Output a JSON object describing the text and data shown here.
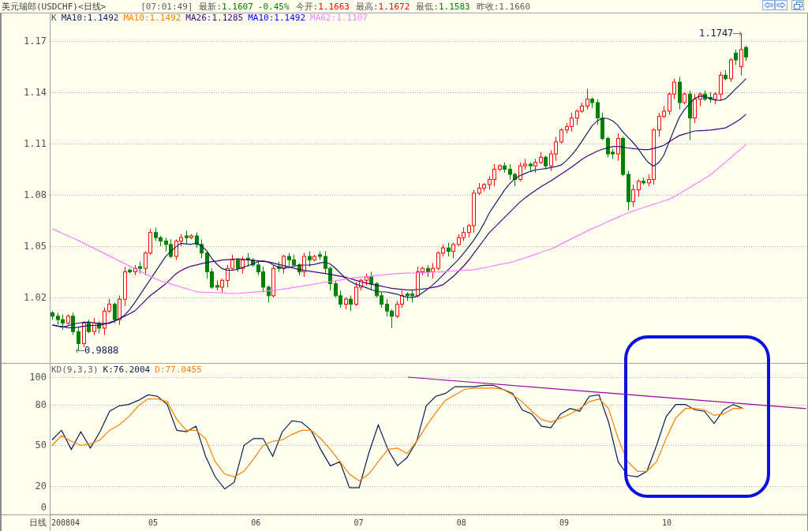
{
  "header": {
    "title": "美元瑞郎(USDCHF)<日线>",
    "time": "[07:01:49]",
    "quotes": [
      {
        "label": "最新:",
        "value": "1.1607",
        "change": "-0.45%",
        "color": "#008000"
      },
      {
        "label": "今开:",
        "value": "1.1663",
        "color": "#ff0000"
      },
      {
        "label": "最高:",
        "value": "1.1672",
        "color": "#ff0000"
      },
      {
        "label": "最低:",
        "value": "1.1583",
        "color": "#008000"
      },
      {
        "label": "昨收:",
        "value": "1.1660",
        "color": "#606060"
      }
    ]
  },
  "price_chart": {
    "legend": [
      {
        "kind": "label",
        "text": "K",
        "color": "#505050"
      },
      {
        "kind": "series",
        "reading": ":1.1492"
      },
      {
        "kind": "label",
        "text": "MA10:1.1492",
        "color": "#ff8000"
      },
      {
        "kind": "series",
        "reading": ":1.1285"
      },
      {
        "kind": "label",
        "text": "MA10:1.1492",
        "color": "#0000ff"
      },
      {
        "kind": "series",
        "reading": ":1.1107"
      }
    ],
    "high_label": "1.1747",
    "low_label": "0.9888",
    "chart_data": {
      "type": "candlestick",
      "xlim": [
        3.525,
        11.366
      ],
      "ylim": [
        0.9812,
        1.1862
      ],
      "yticks": [
        1.17,
        1.14,
        1.11,
        1.08,
        1.05,
        1.02
      ],
      "grid": true,
      "x": [
        4.02,
        4.07,
        4.12,
        4.17,
        4.22,
        4.27,
        4.32,
        4.37,
        4.42,
        4.47,
        4.52,
        4.57,
        4.62,
        4.67,
        4.72,
        4.77,
        4.82,
        4.87,
        4.92,
        4.97,
        5.02,
        5.07,
        5.12,
        5.17,
        5.22,
        5.27,
        5.32,
        5.37,
        5.42,
        5.47,
        5.52,
        5.57,
        5.62,
        5.67,
        5.72,
        5.77,
        5.82,
        5.87,
        5.92,
        5.97,
        6.02,
        6.07,
        6.12,
        6.17,
        6.22,
        6.27,
        6.32,
        6.37,
        6.42,
        6.47,
        6.52,
        6.57,
        6.62,
        6.67,
        6.72,
        6.77,
        6.82,
        6.87,
        6.92,
        6.97,
        7.02,
        7.07,
        7.12,
        7.17,
        7.22,
        7.27,
        7.32,
        7.37,
        7.42,
        7.47,
        7.52,
        7.57,
        7.62,
        7.67,
        7.72,
        7.77,
        7.82,
        7.87,
        7.92,
        7.97,
        8.02,
        8.07,
        8.12,
        8.17,
        8.22,
        8.27,
        8.32,
        8.37,
        8.42,
        8.47,
        8.52,
        8.57,
        8.62,
        8.67,
        8.72,
        8.77,
        8.82,
        8.87,
        8.92,
        8.97,
        9.02,
        9.07,
        9.12,
        9.17,
        9.22,
        9.27,
        9.32,
        9.37,
        9.42,
        9.47,
        9.52,
        9.57,
        9.62,
        9.67,
        9.72,
        9.77,
        9.82,
        9.87,
        9.92,
        9.97,
        10.02,
        10.07,
        10.12,
        10.17,
        10.22,
        10.27,
        10.32,
        10.37,
        10.42,
        10.47,
        10.52,
        10.57,
        10.62,
        10.67,
        10.72,
        10.77
      ],
      "ohlc": [
        [
          1.011,
          1.012,
          1.007,
          1.009
        ],
        [
          1.009,
          1.011,
          1.004,
          1.007
        ],
        [
          1.007,
          1.01,
          1.001,
          1.005
        ],
        [
          1.005,
          1.01,
          1.004,
          1.009
        ],
        [
          1.009,
          1.011,
          0.998,
          1.0
        ],
        [
          1.0,
          1.003,
          0.9888,
          0.993
        ],
        [
          0.993,
          1.006,
          0.991,
          1.005
        ],
        [
          1.005,
          1.007,
          0.999,
          1.0
        ],
        [
          1.0,
          1.008,
          0.998,
          1.005
        ],
        [
          1.005,
          1.006,
          0.999,
          1.002
        ],
        [
          1.002,
          1.014,
          0.998,
          1.012
        ],
        [
          1.012,
          1.019,
          1.011,
          1.016
        ],
        [
          1.016,
          1.017,
          1.005,
          1.007
        ],
        [
          1.007,
          1.021,
          1.004,
          1.019
        ],
        [
          1.019,
          1.038,
          1.015,
          1.035
        ],
        [
          1.036,
          1.037,
          1.034,
          1.035
        ],
        [
          1.035,
          1.039,
          1.033,
          1.037
        ],
        [
          1.038,
          1.041,
          1.034,
          1.037
        ],
        [
          1.037,
          1.047,
          1.033,
          1.046
        ],
        [
          1.046,
          1.06,
          1.045,
          1.058
        ],
        [
          1.058,
          1.061,
          1.053,
          1.055
        ],
        [
          1.055,
          1.056,
          1.05,
          1.053
        ],
        [
          1.053,
          1.055,
          1.047,
          1.051
        ],
        [
          1.051,
          1.054,
          1.043,
          1.044
        ],
        [
          1.044,
          1.054,
          1.042,
          1.053
        ],
        [
          1.053,
          1.057,
          1.05,
          1.055
        ],
        [
          1.056,
          1.059,
          1.051,
          1.055
        ],
        [
          1.055,
          1.057,
          1.054,
          1.056
        ],
        [
          1.056,
          1.058,
          1.049,
          1.051
        ],
        [
          1.051,
          1.054,
          1.043,
          1.046
        ],
        [
          1.046,
          1.047,
          1.031,
          1.035
        ],
        [
          1.035,
          1.037,
          1.025,
          1.026
        ],
        [
          1.027,
          1.03,
          1.024,
          1.026
        ],
        [
          1.026,
          1.031,
          1.023,
          1.03
        ],
        [
          1.03,
          1.039,
          1.026,
          1.037
        ],
        [
          1.037,
          1.045,
          1.036,
          1.042
        ],
        [
          1.042,
          1.043,
          1.035,
          1.037
        ],
        [
          1.037,
          1.044,
          1.034,
          1.042
        ],
        [
          1.043,
          1.046,
          1.038,
          1.042
        ],
        [
          1.042,
          1.043,
          1.038,
          1.039
        ],
        [
          1.039,
          1.041,
          1.033,
          1.035
        ],
        [
          1.035,
          1.038,
          1.023,
          1.026
        ],
        [
          1.026,
          1.027,
          1.017,
          1.021
        ],
        [
          1.021,
          1.039,
          1.02,
          1.037
        ],
        [
          1.038,
          1.041,
          1.035,
          1.037
        ],
        [
          1.037,
          1.045,
          1.034,
          1.044
        ],
        [
          1.044,
          1.046,
          1.038,
          1.042
        ],
        [
          1.042,
          1.045,
          1.038,
          1.039
        ],
        [
          1.039,
          1.04,
          1.033,
          1.035
        ],
        [
          1.035,
          1.046,
          1.032,
          1.044
        ],
        [
          1.044,
          1.047,
          1.038,
          1.042
        ],
        [
          1.042,
          1.045,
          1.041,
          1.044
        ],
        [
          1.045,
          1.047,
          1.042,
          1.044
        ],
        [
          1.044,
          1.047,
          1.034,
          1.037
        ],
        [
          1.037,
          1.038,
          1.024,
          1.028
        ],
        [
          1.028,
          1.03,
          1.02,
          1.021
        ],
        [
          1.021,
          1.024,
          1.014,
          1.016
        ],
        [
          1.016,
          1.02,
          1.013,
          1.019
        ],
        [
          1.019,
          1.021,
          1.012,
          1.016
        ],
        [
          1.016,
          1.029,
          1.015,
          1.026
        ],
        [
          1.026,
          1.031,
          1.024,
          1.03
        ],
        [
          1.03,
          1.034,
          1.027,
          1.032
        ],
        [
          1.032,
          1.035,
          1.024,
          1.028
        ],
        [
          1.028,
          1.029,
          1.02,
          1.021
        ],
        [
          1.021,
          1.023,
          1.014,
          1.016
        ],
        [
          1.016,
          1.019,
          1.009,
          1.012
        ],
        [
          1.012,
          1.013,
          1.002,
          1.009
        ],
        [
          1.009,
          1.018,
          1.008,
          1.016
        ],
        [
          1.016,
          1.024,
          1.014,
          1.021
        ],
        [
          1.022,
          1.023,
          1.018,
          1.021
        ],
        [
          1.022,
          1.024,
          1.017,
          1.021
        ],
        [
          1.021,
          1.038,
          1.02,
          1.035
        ],
        [
          1.035,
          1.038,
          1.033,
          1.037
        ],
        [
          1.037,
          1.039,
          1.032,
          1.035
        ],
        [
          1.035,
          1.04,
          1.031,
          1.037
        ],
        [
          1.037,
          1.047,
          1.036,
          1.046
        ],
        [
          1.046,
          1.051,
          1.044,
          1.049
        ],
        [
          1.049,
          1.052,
          1.044,
          1.047
        ],
        [
          1.047,
          1.052,
          1.043,
          1.051
        ],
        [
          1.051,
          1.057,
          1.05,
          1.055
        ],
        [
          1.055,
          1.061,
          1.053,
          1.058
        ],
        [
          1.058,
          1.063,
          1.055,
          1.062
        ],
        [
          1.062,
          1.083,
          1.058,
          1.081
        ],
        [
          1.081,
          1.087,
          1.08,
          1.084
        ],
        [
          1.084,
          1.087,
          1.082,
          1.086
        ],
        [
          1.086,
          1.091,
          1.083,
          1.089
        ],
        [
          1.089,
          1.098,
          1.085,
          1.095
        ],
        [
          1.095,
          1.098,
          1.094,
          1.097
        ],
        [
          1.097,
          1.099,
          1.093,
          1.095
        ],
        [
          1.095,
          1.098,
          1.089,
          1.092
        ],
        [
          1.092,
          1.093,
          1.085,
          1.089
        ],
        [
          1.089,
          1.099,
          1.088,
          1.097
        ],
        [
          1.097,
          1.101,
          1.095,
          1.098
        ],
        [
          1.098,
          1.099,
          1.094,
          1.097
        ],
        [
          1.097,
          1.101,
          1.093,
          1.099
        ],
        [
          1.099,
          1.105,
          1.098,
          1.102
        ],
        [
          1.102,
          1.103,
          1.095,
          1.097
        ],
        [
          1.097,
          1.106,
          1.094,
          1.104
        ],
        [
          1.104,
          1.114,
          1.1,
          1.111
        ],
        [
          1.111,
          1.119,
          1.11,
          1.118
        ],
        [
          1.118,
          1.122,
          1.116,
          1.12
        ],
        [
          1.12,
          1.128,
          1.117,
          1.125
        ],
        [
          1.125,
          1.13,
          1.121,
          1.129
        ],
        [
          1.129,
          1.134,
          1.128,
          1.132
        ],
        [
          1.132,
          1.142,
          1.13,
          1.136
        ],
        [
          1.136,
          1.137,
          1.131,
          1.134
        ],
        [
          1.134,
          1.136,
          1.121,
          1.125
        ],
        [
          1.125,
          1.128,
          1.112,
          1.113
        ],
        [
          1.113,
          1.114,
          1.102,
          1.104
        ],
        [
          1.105,
          1.107,
          1.101,
          1.104
        ],
        [
          1.104,
          1.116,
          1.1,
          1.113
        ],
        [
          1.113,
          1.114,
          1.091,
          1.092
        ],
        [
          1.092,
          1.094,
          1.071,
          1.076
        ],
        [
          1.076,
          1.086,
          1.073,
          1.083
        ],
        [
          1.083,
          1.089,
          1.079,
          1.088
        ],
        [
          1.088,
          1.09,
          1.086,
          1.087
        ],
        [
          1.087,
          1.092,
          1.085,
          1.089
        ],
        [
          1.089,
          1.119,
          1.086,
          1.118
        ],
        [
          1.118,
          1.128,
          1.114,
          1.126
        ],
        [
          1.126,
          1.132,
          1.125,
          1.129
        ],
        [
          1.129,
          1.14,
          1.127,
          1.139
        ],
        [
          1.139,
          1.148,
          1.136,
          1.146
        ],
        [
          1.146,
          1.149,
          1.13,
          1.134
        ],
        [
          1.134,
          1.14,
          1.133,
          1.139
        ],
        [
          1.139,
          1.141,
          1.112,
          1.125
        ],
        [
          1.125,
          1.139,
          1.122,
          1.136
        ],
        [
          1.136,
          1.14,
          1.132,
          1.139
        ],
        [
          1.139,
          1.141,
          1.135,
          1.136
        ],
        [
          1.137,
          1.14,
          1.134,
          1.136
        ],
        [
          1.136,
          1.14,
          1.133,
          1.139
        ],
        [
          1.139,
          1.152,
          1.135,
          1.15
        ],
        [
          1.15,
          1.153,
          1.147,
          1.148
        ],
        [
          1.148,
          1.16,
          1.146,
          1.159
        ],
        [
          1.163,
          1.165,
          1.156,
          1.159
        ],
        [
          1.155,
          1.1747,
          1.15,
          1.165
        ],
        [
          1.1663,
          1.1672,
          1.1583,
          1.1607
        ]
      ]
    },
    "averages": {
      "chart_data": {
        "type": "line",
        "xlim": [
          3.525,
          11.366
        ],
        "ylim": [
          0.9812,
          1.1862
        ],
        "x": [
          4.02,
          4.07,
          4.12,
          4.17,
          4.22,
          4.27,
          4.32,
          4.37,
          4.42,
          4.47,
          4.52,
          4.57,
          4.62,
          4.67,
          4.72,
          4.77,
          4.82,
          4.87,
          4.92,
          4.97,
          5.02,
          5.07,
          5.12,
          5.17,
          5.22,
          5.27,
          5.32,
          5.37,
          5.42,
          5.47,
          5.52,
          5.57,
          5.62,
          5.67,
          5.72,
          5.77,
          5.82,
          5.87,
          5.92,
          5.97,
          6.02,
          6.07,
          6.12,
          6.17,
          6.22,
          6.27,
          6.32,
          6.37,
          6.42,
          6.47,
          6.52,
          6.57,
          6.62,
          6.67,
          6.72,
          6.77,
          6.82,
          6.87,
          6.92,
          6.97,
          7.02,
          7.07,
          7.12,
          7.17,
          7.22,
          7.27,
          7.32,
          7.37,
          7.42,
          7.47,
          7.52,
          7.57,
          7.62,
          7.67,
          7.72,
          7.77,
          7.82,
          7.87,
          7.92,
          7.97,
          8.02,
          8.07,
          8.12,
          8.17,
          8.22,
          8.27,
          8.32,
          8.37,
          8.42,
          8.47,
          8.52,
          8.57,
          8.62,
          8.67,
          8.72,
          8.77,
          8.82,
          8.87,
          8.92,
          8.97,
          9.02,
          9.07,
          9.12,
          9.17,
          9.22,
          9.27,
          9.32,
          9.37,
          9.42,
          9.47,
          9.52,
          9.57,
          9.62,
          9.67,
          9.72,
          9.77,
          9.82,
          9.87,
          9.92,
          9.97,
          10.02,
          10.07,
          10.12,
          10.17,
          10.22,
          10.27,
          10.32,
          10.37,
          10.42,
          10.47,
          10.52,
          10.57,
          10.62,
          10.67,
          10.72,
          10.77
        ],
        "series": [
          {
            "name": "MA10",
            "color": "#14206e",
            "values": [
              1.0039,
              1.0032,
              1.0026,
              1.0034,
              1.0044,
              1.005,
              1.0054,
              1.0056,
              1.0052,
              1.0048,
              1.0048,
              1.0048,
              1.0059,
              1.0075,
              1.0095,
              1.0128,
              1.0168,
              1.0213,
              1.0258,
              1.0303,
              1.0348,
              1.0393,
              1.0438,
              1.0469,
              1.0495,
              1.0517,
              1.0513,
              1.0511,
              1.0518,
              1.0502,
              1.0474,
              1.0429,
              1.0395,
              1.0369,
              1.036,
              1.0359,
              1.0364,
              1.0375,
              1.0386,
              1.0395,
              1.041,
              1.0414,
              1.0408,
              1.039,
              1.0377,
              1.0371,
              1.0376,
              1.0382,
              1.0388,
              1.0389,
              1.039,
              1.0393,
              1.0401,
              1.0406,
              1.0397,
              1.0373,
              1.0343,
              1.0313,
              1.0293,
              1.0278,
              1.0269,
              1.0258,
              1.0246,
              1.0237,
              1.0232,
              1.0232,
              1.0226,
              1.0219,
              1.021,
              1.0202,
              1.0199,
              1.0207,
              1.0226,
              1.0248,
              1.0272,
              1.0301,
              1.0331,
              1.0361,
              1.0391,
              1.0421,
              1.0457,
              1.0495,
              1.0534,
              1.058,
              1.0632,
              1.0693,
              1.0738,
              1.0783,
              1.0828,
              1.0865,
              1.0895,
              1.0912,
              1.0925,
              1.0937,
              1.0946,
              1.095,
              1.0954,
              1.096,
              1.0966,
              1.0975,
              1.0999,
              1.103,
              1.1067,
              1.1111,
              1.1157,
              1.1202,
              1.1232,
              1.1248,
              1.1248,
              1.1234,
              1.1209,
              1.117,
              1.1139,
              1.1107,
              1.1071,
              1.1027,
              1.0989,
              1.0968,
              1.0988,
              1.1031,
              1.1106,
              1.1181,
              1.1253,
              1.1298,
              1.1334,
              1.1364,
              1.1379,
              1.1378,
              1.1363,
              1.1354,
              1.1353,
              1.1362,
              1.139,
              1.142,
              1.1449,
              1.148
            ]
          },
          {
            "name": "MA26",
            "color": "#400080",
            "values": [
              1.0039,
              1.0033,
              1.0028,
              1.0023,
              1.0022,
              1.0026,
              1.0031,
              1.0035,
              1.0036,
              1.0038,
              1.0042,
              1.0052,
              1.0062,
              1.0074,
              1.0089,
              1.0104,
              1.012,
              1.015,
              1.018,
              1.021,
              1.0232,
              1.0255,
              1.0278,
              1.0308,
              1.0337,
              1.0357,
              1.0371,
              1.0383,
              1.039,
              1.0398,
              1.0404,
              1.0409,
              1.0413,
              1.0418,
              1.0421,
              1.0423,
              1.0426,
              1.0423,
              1.042,
              1.0417,
              1.0414,
              1.0411,
              1.0408,
              1.0401,
              1.0393,
              1.0386,
              1.0378,
              1.0371,
              1.0363,
              1.0358,
              1.0354,
              1.0349,
              1.0345,
              1.034,
              1.0335,
              1.033,
              1.0324,
              1.0318,
              1.031,
              1.0301,
              1.0292,
              1.0285,
              1.0278,
              1.0272,
              1.0266,
              1.026,
              1.0254,
              1.025,
              1.0247,
              1.0244,
              1.0243,
              1.0246,
              1.0249,
              1.0253,
              1.0258,
              1.0264,
              1.0274,
              1.0298,
              1.0322,
              1.0352,
              1.0382,
              1.0417,
              1.0457,
              1.0497,
              1.0537,
              1.0578,
              1.0608,
              1.0638,
              1.0668,
              1.0698,
              1.0728,
              1.0758,
              1.0782,
              1.0804,
              1.0826,
              1.0846,
              1.0864,
              1.0882,
              1.0902,
              1.0921,
              1.0941,
              1.0962,
              1.0984,
              1.1007,
              1.1025,
              1.104,
              1.1055,
              1.1067,
              1.1074,
              1.1082,
              1.1084,
              1.108,
              1.1075,
              1.1071,
              1.1068,
              1.1065,
              1.1065,
              1.1072,
              1.108,
              1.109,
              1.1109,
              1.1129,
              1.1147,
              1.1156,
              1.1165,
              1.1174,
              1.1176,
              1.1177,
              1.1179,
              1.1183,
              1.1187,
              1.1192,
              1.1208,
              1.1226,
              1.1245,
              1.1273
            ]
          },
          {
            "name": "MA62",
            "color": "#ff80ff",
            "values": [
              1.0601,
              1.0588,
              1.0574,
              1.0561,
              1.0547,
              1.0534,
              1.0519,
              1.0504,
              1.0489,
              1.0474,
              1.0459,
              1.0444,
              1.0429,
              1.0414,
              1.0399,
              1.0384,
              1.0369,
              1.0354,
              1.0339,
              1.0324,
              1.031,
              1.0298,
              1.0288,
              1.0279,
              1.027,
              1.0261,
              1.0252,
              1.0243,
              1.0234,
              1.0231,
              1.023,
              1.0229,
              1.0228,
              1.0227,
              1.0225,
              1.0224,
              1.0223,
              1.0226,
              1.0228,
              1.0231,
              1.0233,
              1.0236,
              1.0238,
              1.0241,
              1.0244,
              1.0249,
              1.0254,
              1.0259,
              1.0263,
              1.0268,
              1.0273,
              1.0278,
              1.0283,
              1.0288,
              1.0292,
              1.0297,
              1.0302,
              1.0307,
              1.0312,
              1.0316,
              1.0319,
              1.0322,
              1.0325,
              1.0328,
              1.0331,
              1.0334,
              1.0337,
              1.034,
              1.0341,
              1.0342,
              1.0343,
              1.0344,
              1.0345,
              1.0346,
              1.0348,
              1.0349,
              1.0351,
              1.0353,
              1.0355,
              1.0357,
              1.0358,
              1.036,
              1.0362,
              1.0368,
              1.0374,
              1.038,
              1.0386,
              1.0392,
              1.0398,
              1.0404,
              1.0412,
              1.0422,
              1.0432,
              1.0442,
              1.0452,
              1.0463,
              1.0473,
              1.0483,
              1.0496,
              1.0512,
              1.0527,
              1.0542,
              1.0557,
              1.0572,
              1.0587,
              1.0602,
              1.0615,
              1.0628,
              1.0642,
              1.0655,
              1.0668,
              1.0681,
              1.0694,
              1.0706,
              1.0716,
              1.0725,
              1.0735,
              1.0745,
              1.0754,
              1.0764,
              1.0774,
              1.0789,
              1.0807,
              1.0824,
              1.0842,
              1.0861,
              1.0879,
              1.0897,
              1.0914,
              1.094,
              1.0966,
              1.0991,
              1.1017,
              1.1043,
              1.1069,
              1.1095
            ]
          }
        ]
      }
    }
  },
  "kd_chart": {
    "readings": [
      ":76.2004",
      ":77.0455"
    ],
    "chart_data": {
      "type": "line",
      "title": "KD(9,3,3)",
      "xlim": [
        3.525,
        11.366
      ],
      "ylim": [
        -0.6,
        109.8
      ],
      "grid": true,
      "x": [
        4.016,
        4.109,
        4.203,
        4.296,
        4.39,
        4.483,
        4.576,
        4.67,
        4.763,
        4.857,
        4.95,
        5.043,
        5.137,
        5.23,
        5.324,
        5.417,
        5.51,
        5.604,
        5.697,
        5.79,
        5.884,
        5.977,
        6.071,
        6.164,
        6.257,
        6.351,
        6.444,
        6.538,
        6.631,
        6.724,
        6.818,
        6.911,
        7.005,
        7.098,
        7.191,
        7.285,
        7.378,
        7.471,
        7.565,
        7.658,
        7.752,
        7.845,
        7.938,
        8.032,
        8.125,
        8.219,
        8.312,
        8.405,
        8.499,
        8.592,
        8.686,
        8.779,
        8.872,
        8.966,
        9.059,
        9.152,
        9.246,
        9.339,
        9.433,
        9.526,
        9.619,
        9.713,
        9.806,
        9.9,
        9.993,
        10.086,
        10.18,
        10.273,
        10.366,
        10.46,
        10.553,
        10.647,
        10.74
      ],
      "xticks": [
        {
          "value": 5,
          "label": "05"
        },
        {
          "value": 6,
          "label": "06"
        },
        {
          "value": 7,
          "label": "07"
        },
        {
          "value": 8,
          "label": "08"
        },
        {
          "value": 9,
          "label": "09"
        },
        {
          "value": 10,
          "label": "10"
        }
      ],
      "yticks": [
        100,
        80,
        50,
        20,
        0
      ],
      "series": [
        {
          "name": "K",
          "color": "#0c1c50",
          "values": [
            54,
            61,
            47,
            60,
            48,
            60,
            75,
            79,
            80,
            83,
            87,
            86,
            80,
            61,
            60,
            64,
            42,
            27,
            18,
            23,
            50,
            55,
            55,
            42,
            60,
            68,
            67,
            61,
            47,
            35,
            38,
            19,
            19,
            44,
            65,
            47,
            35,
            41,
            53,
            79,
            86,
            88,
            93,
            93,
            93,
            94,
            94,
            91,
            88,
            76,
            73,
            64,
            63,
            73,
            77,
            75,
            86,
            87,
            67,
            38,
            28,
            27,
            31,
            50,
            71,
            80,
            80,
            76,
            75,
            66,
            76,
            80,
            77
          ]
        },
        {
          "name": "D",
          "color": "#ff8000",
          "values": [
            50,
            57,
            53,
            50,
            51,
            54,
            61,
            65,
            71,
            79,
            84,
            84,
            82,
            69,
            61,
            61,
            55,
            38,
            29,
            27,
            31,
            40,
            50,
            53,
            54,
            58,
            61,
            61,
            55,
            47,
            38,
            29,
            24,
            29,
            38,
            47,
            48,
            44,
            53,
            64,
            74,
            83,
            87,
            91,
            92,
            92,
            92,
            91,
            87,
            82,
            75,
            69,
            67,
            70,
            73,
            77,
            82,
            84,
            77,
            55,
            38,
            31,
            31,
            38,
            55,
            70,
            77,
            77,
            76,
            72,
            73,
            77,
            77
          ]
        }
      ]
    }
  },
  "time_axis": {
    "label": "日线",
    "start_label": "200804"
  }
}
